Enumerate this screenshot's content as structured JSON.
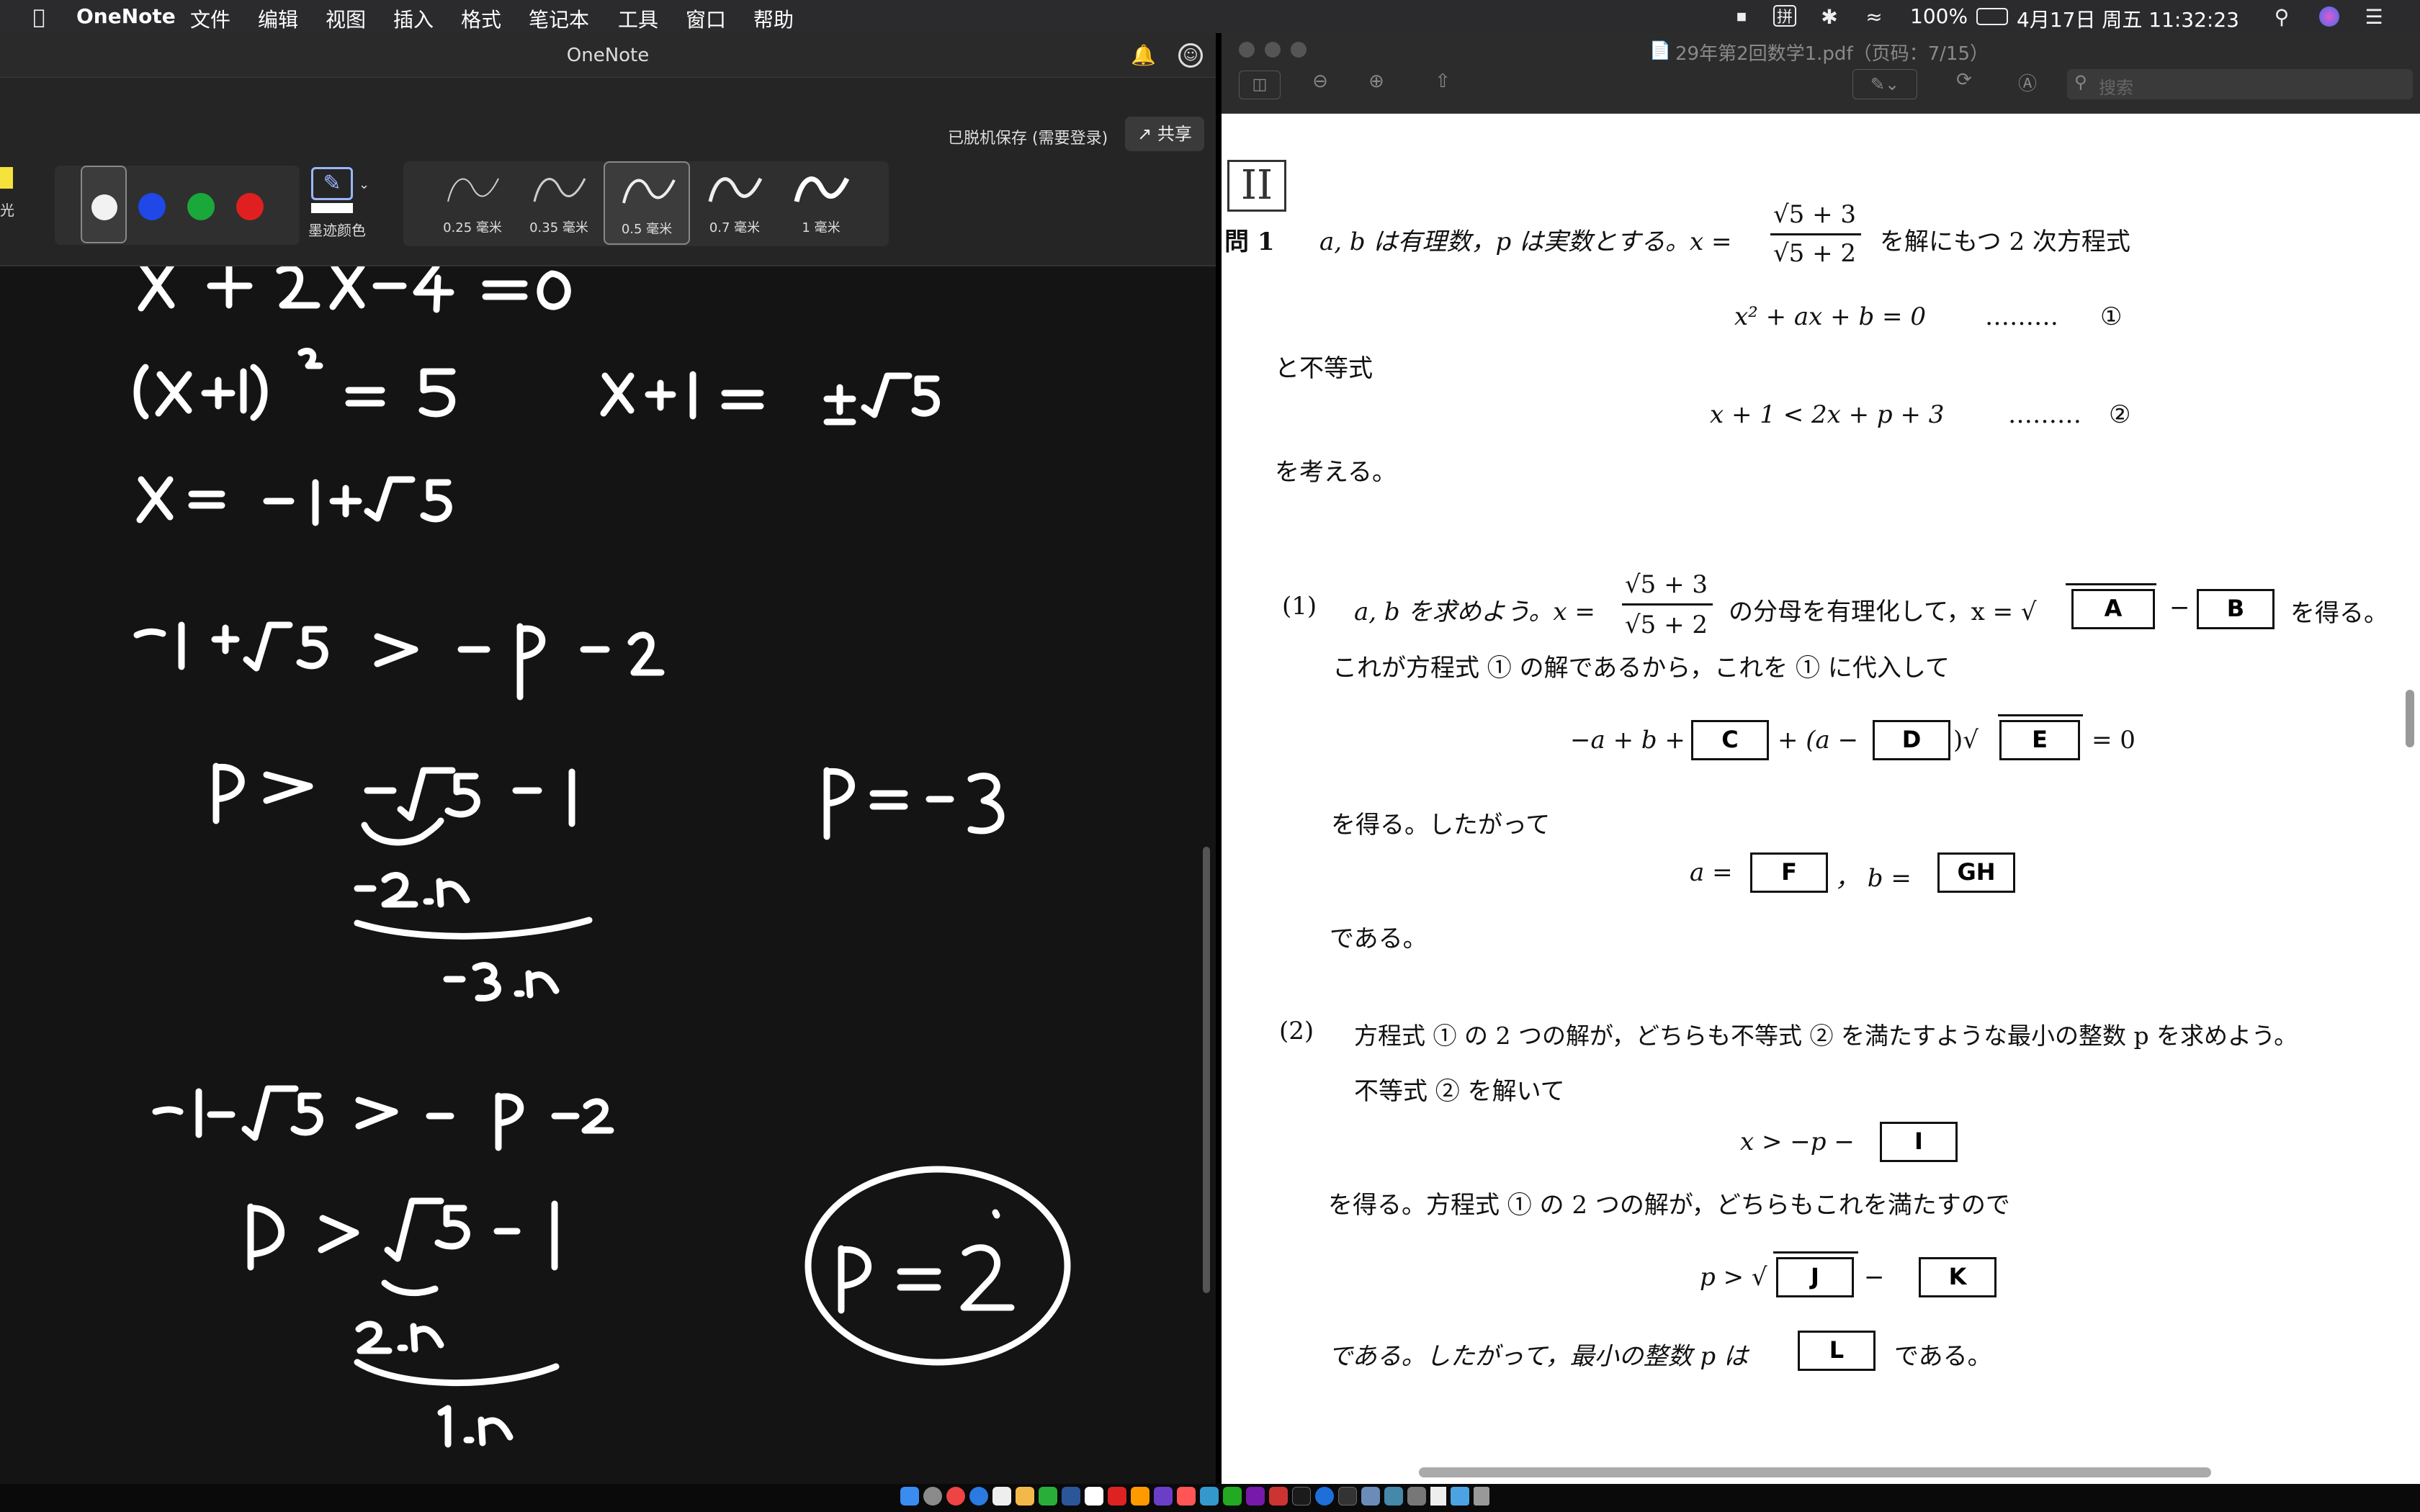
{
  "menubar": {
    "app_name": "OneNote",
    "menus": [
      "文件",
      "编辑",
      "视图",
      "插入",
      "格式",
      "笔记本",
      "工具",
      "窗口",
      "帮助"
    ],
    "battery": "100%",
    "datetime": "4月17日 周五 11:32:23",
    "input_method": "拼"
  },
  "onenote": {
    "window_title": "OneNote",
    "save_status": "已脱机保存 (需要登录)",
    "share_label": "共享",
    "highlighter_label": "光",
    "ink_color_label": "墨迹颜色",
    "pen_colors": [
      "#ffffff",
      "#1f48e6",
      "#1aa83b",
      "#e02020"
    ],
    "thickness_options": [
      "0.25 毫米",
      "0.35 毫米",
      "0.5 毫米",
      "0.7 毫米",
      "1 毫米"
    ],
    "selected_thickness": "0.5 毫米"
  },
  "pdf": {
    "title": "29年第2回数学1.pdf（页码：7/15）",
    "search_placeholder": "搜索",
    "section": "II",
    "q1_label": "問 1",
    "q1_text_a": "a, b は有理数，p は実数とする。x =",
    "q1_text_b": "を解にもつ 2 次方程式",
    "frac_num": "√5 + 3",
    "frac_den": "√5 + 2",
    "eq1": "x² + ax + b = 0",
    "eq1_dots": "………",
    "eq1_mark": "①",
    "and_ineq": "と不等式",
    "eq2": "x + 1 < 2x + p + 3",
    "eq2_dots": "………",
    "eq2_mark": "②",
    "consider": "を考える。",
    "p1_label": "(1)",
    "p1_text_a": "a, b を求めよう。x =",
    "p1_text_b": "の分母を有理化して，x = √",
    "p1_minus": "−",
    "p1_text_c": "を得る。",
    "p1_line2": "これが方程式 ① の解であるから，これを ① に代入して",
    "p1_eq_a": "−a + b +",
    "p1_eq_b": "+ (a −",
    "p1_eq_c": ")√",
    "p1_eq_d": "= 0",
    "p1_line3": "を得る。したがって",
    "p1_a_eq": "a =",
    "p1_b_eq": "，   b =",
    "p1_end": "である。",
    "p2_label": "(2)",
    "p2_text": "方程式 ① の 2 つの解が，どちらも不等式 ② を満たすような最小の整数 p を求めよう。",
    "p2_line2": "不等式 ② を解いて",
    "p2_ineq": "x > −p −",
    "p2_line3": "を得る。方程式 ① の 2 つの解が，どちらもこれを満たすので",
    "p2_p_ineq": "p > √",
    "p2_minus": "−",
    "p2_end_a": "である。したがって，最小の整数 p は",
    "p2_end_b": "である。",
    "boxes": {
      "A": "A",
      "B": "B",
      "C": "C",
      "D": "D",
      "E": "E",
      "F": "F",
      "GH": "GH",
      "I": "I",
      "J": "J",
      "K": "K",
      "L": "L"
    }
  }
}
